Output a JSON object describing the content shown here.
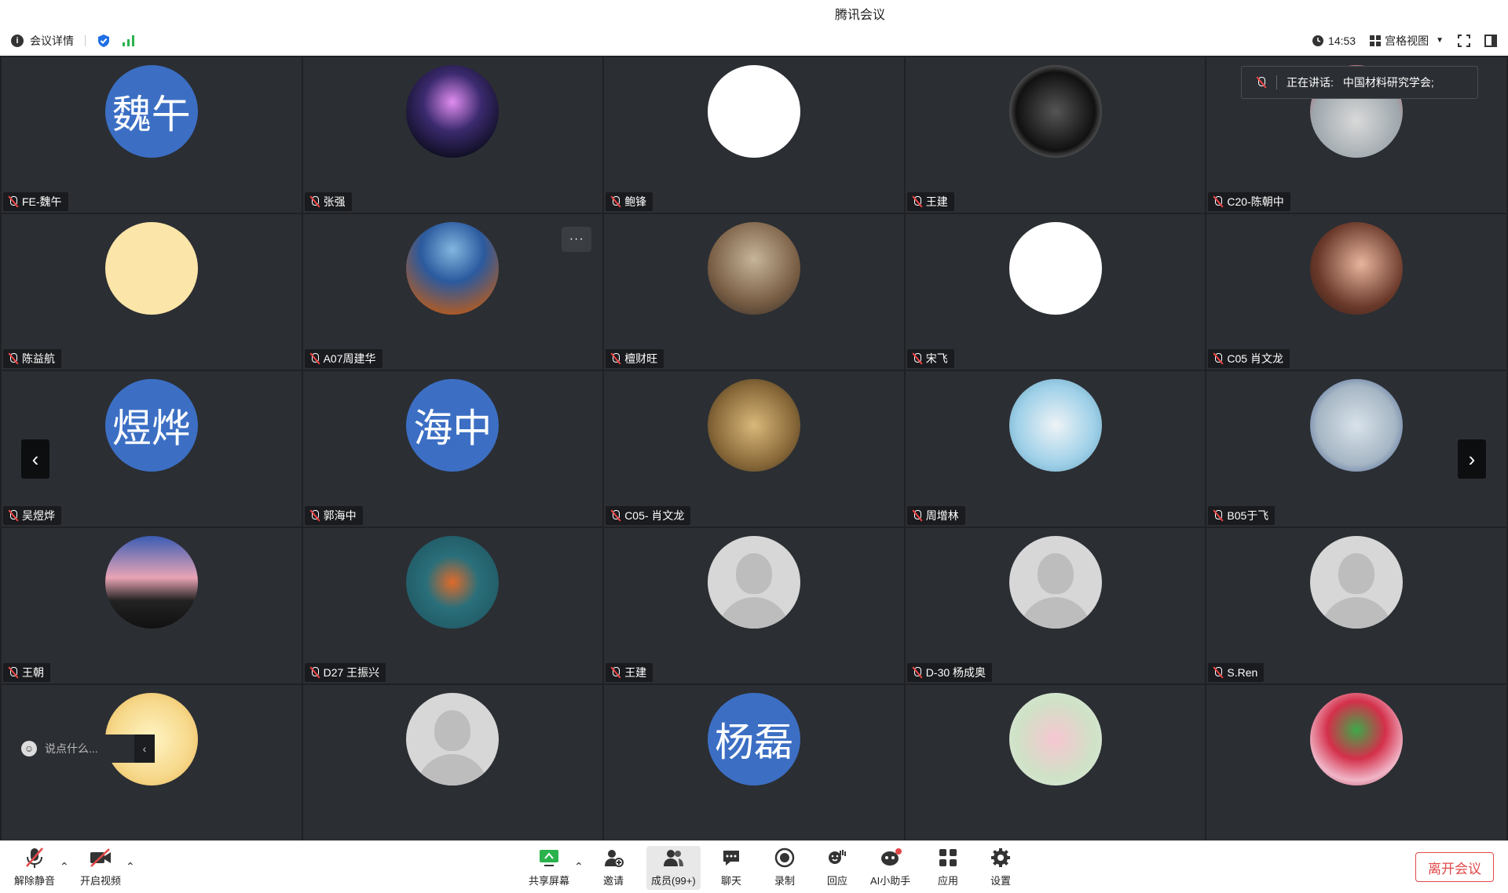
{
  "window": {
    "title": "腾讯会议"
  },
  "top_toolbar": {
    "meeting_details": "会议详情",
    "time": "14:53",
    "view_mode": "宫格视图"
  },
  "speaking": {
    "label": "正在讲话:",
    "name": "中国材料研究学会;"
  },
  "participants": [
    {
      "name": "FE-魏午",
      "avatar_text": "魏午",
      "avatar": "blue"
    },
    {
      "name": "张强",
      "avatar": "photo-city"
    },
    {
      "name": "鲍锋",
      "avatar": "photo-boy"
    },
    {
      "name": "王建",
      "avatar": "photo-anime"
    },
    {
      "name": "C20-陈朝中",
      "avatar": "photo-snow"
    },
    {
      "name": "陈益航",
      "avatar": "photo-pooh"
    },
    {
      "name": "A07周建华",
      "avatar": "photo-astro"
    },
    {
      "name": "檀财旺",
      "avatar": "photo-arch"
    },
    {
      "name": "宋飞",
      "avatar": "photo-monkey"
    },
    {
      "name": "C05 肖文龙",
      "avatar": "photo-girl"
    },
    {
      "name": "吴煜烨",
      "avatar_text": "煜烨",
      "avatar": "blue"
    },
    {
      "name": "郭海中",
      "avatar_text": "海中",
      "avatar": "blue"
    },
    {
      "name": "C05- 肖文龙",
      "avatar": "photo-hands"
    },
    {
      "name": "周增林",
      "avatar": "photo-kids"
    },
    {
      "name": "B05于飞",
      "avatar": "photo-child"
    },
    {
      "name": "王朝",
      "avatar": "photo-sunset"
    },
    {
      "name": "D27 王振兴",
      "avatar": "photo-koi"
    },
    {
      "name": "王建",
      "avatar": "default"
    },
    {
      "name": "D-30 杨成奥",
      "avatar": "default"
    },
    {
      "name": "S.Ren",
      "avatar": "default"
    },
    {
      "name": "",
      "avatar": "photo-cartoon"
    },
    {
      "name": "",
      "avatar": "default"
    },
    {
      "name": "",
      "avatar_text": "杨磊",
      "avatar": "blue"
    },
    {
      "name": "",
      "avatar": "photo-lotus"
    },
    {
      "name": "",
      "avatar": "photo-leaves"
    }
  ],
  "chat": {
    "placeholder": "说点什么..."
  },
  "bottom_toolbar": {
    "unmute": "解除静音",
    "start_video": "开启视频",
    "share_screen": "共享屏幕",
    "invite": "邀请",
    "members": "成员(99+)",
    "chat": "聊天",
    "record": "录制",
    "react": "回应",
    "ai_assistant": "AI小助手",
    "apps": "应用",
    "settings": "设置",
    "leave": "离开会议"
  },
  "colors": {
    "accent_blue": "#3c6fc4",
    "leave_red": "#e24848",
    "tile_bg": "#2b2e33"
  }
}
